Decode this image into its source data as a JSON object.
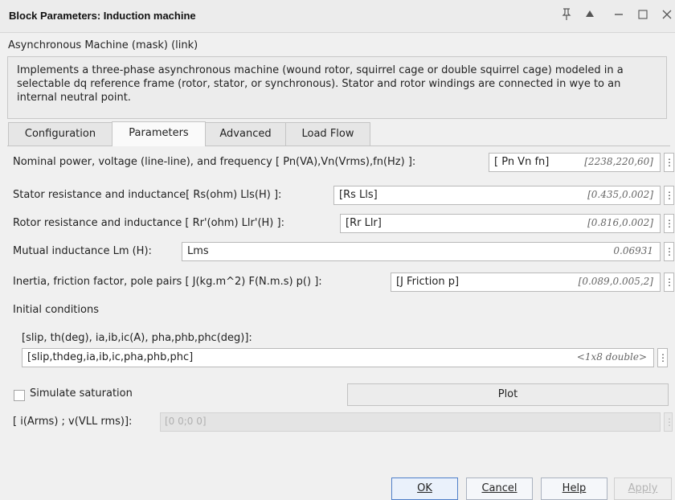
{
  "window": {
    "title": "Block Parameters: Induction machine",
    "buttons": [
      "pin",
      "expand-up",
      "minimize",
      "maximize",
      "close"
    ]
  },
  "header": {
    "subtitle": "Asynchronous Machine (mask) (link)",
    "description": "Implements a three-phase asynchronous machine (wound rotor, squirrel cage or double squirrel cage) modeled in a selectable dq reference frame (rotor, stator, or synchronous). Stator and rotor windings are connected in wye to an internal neutral point."
  },
  "tabs": [
    "Configuration",
    "Parameters",
    "Advanced",
    "Load Flow"
  ],
  "active_tab": "Parameters",
  "params": [
    {
      "label": "Nominal power, voltage (line-line), and frequency [ Pn(VA),Vn(Vrms),fn(Hz) ]:",
      "expr": "[ Pn  Vn  fn]",
      "value": "[2238,220,60]"
    },
    {
      "label": "Stator resistance and inductance[ Rs(ohm)  Lls(H) ]:",
      "expr": "[Rs Lls]",
      "value": "[0.435,0.002]"
    },
    {
      "label": "Rotor resistance and inductance [ Rr'(ohm)  Llr'(H) ]:",
      "expr": "[Rr Llr]",
      "value": "[0.816,0.002]"
    },
    {
      "label": "Mutual inductance Lm (H):",
      "expr": "Lms",
      "value": "0.06931"
    },
    {
      "label": "Inertia, friction factor, pole pairs [ J(kg.m^2)  F(N.m.s)  p() ]:",
      "expr": "[J  Friction  p]",
      "value": "[0.089,0.005,2]"
    }
  ],
  "initial_conditions": {
    "section_label": "Initial conditions",
    "label": "[slip, th(deg), ia,ib,ic(A), pha,phb,phc(deg)]:",
    "expr": "[slip,thdeg,ia,ib,ic,pha,phb,phc]",
    "value": "<1x8 double>"
  },
  "saturation": {
    "checkbox_label": "Simulate saturation",
    "checked": false,
    "plot_label": "Plot",
    "field_label": "[ i(Arms) ; v(VLL rms)]:",
    "field_value": "[0 0;0 0]"
  },
  "footer": {
    "ok": "OK",
    "cancel": "Cancel",
    "help": "Help",
    "apply": "Apply"
  },
  "colors": {
    "window_bg": "#f0f0f0",
    "ok_border": "#4f7fc9"
  }
}
